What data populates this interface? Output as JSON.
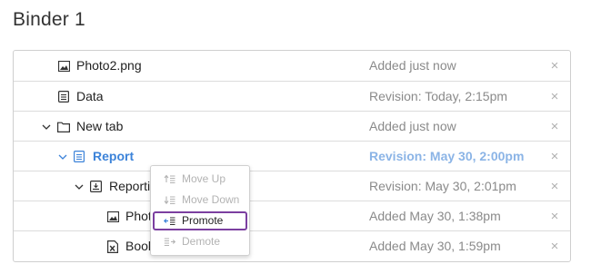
{
  "page": {
    "title": "Binder 1"
  },
  "colors": {
    "accent": "#3c83d9",
    "focus_outline": "#7b3fa0"
  },
  "rows": [
    {
      "name": "Photo2.png",
      "status": "Added just now",
      "icon": "image-icon",
      "close": "×"
    },
    {
      "name": "Data",
      "status": "Revision: Today, 2:15pm",
      "icon": "document-icon",
      "close": "×"
    },
    {
      "name": "New tab",
      "status": "Added just now",
      "icon": "folder-icon",
      "close": "×"
    },
    {
      "name": "Report",
      "status": "Revision: May 30, 2:00pm",
      "icon": "document-icon",
      "close": "×",
      "selected": true
    },
    {
      "name": "Reportin",
      "status": "Revision: May 30, 2:01pm",
      "icon": "report-icon",
      "close": "×"
    },
    {
      "name": "Phot",
      "status": "Added May 30, 1:38pm",
      "icon": "image-icon",
      "close": "×"
    },
    {
      "name": "Book",
      "status": "Added May 30, 1:59pm",
      "icon": "excel-icon",
      "close": "×"
    }
  ],
  "context_menu": {
    "items": [
      {
        "label": "Move Up",
        "enabled": false,
        "icon": "move-up-icon"
      },
      {
        "label": "Move Down",
        "enabled": false,
        "icon": "move-down-icon"
      },
      {
        "label": "Promote",
        "enabled": true,
        "icon": "promote-icon",
        "focused": true
      },
      {
        "label": "Demote",
        "enabled": false,
        "icon": "demote-icon"
      }
    ]
  }
}
